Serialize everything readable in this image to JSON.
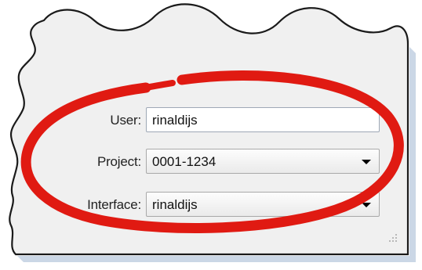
{
  "form": {
    "user": {
      "label": "User:",
      "value": "rinaldijs"
    },
    "project": {
      "label": "Project:",
      "value": "0001-1234",
      "icon": "dropdown-arrow-icon"
    },
    "interface": {
      "label": "Interface:",
      "value": "rinaldijs",
      "icon": "dropdown-arrow-icon"
    }
  },
  "colors": {
    "panel": "#f0f0f0",
    "panel_edge": "#1a1a1a",
    "shadow": "#9fb4cf",
    "highlight_ellipse": "#e01a12"
  }
}
